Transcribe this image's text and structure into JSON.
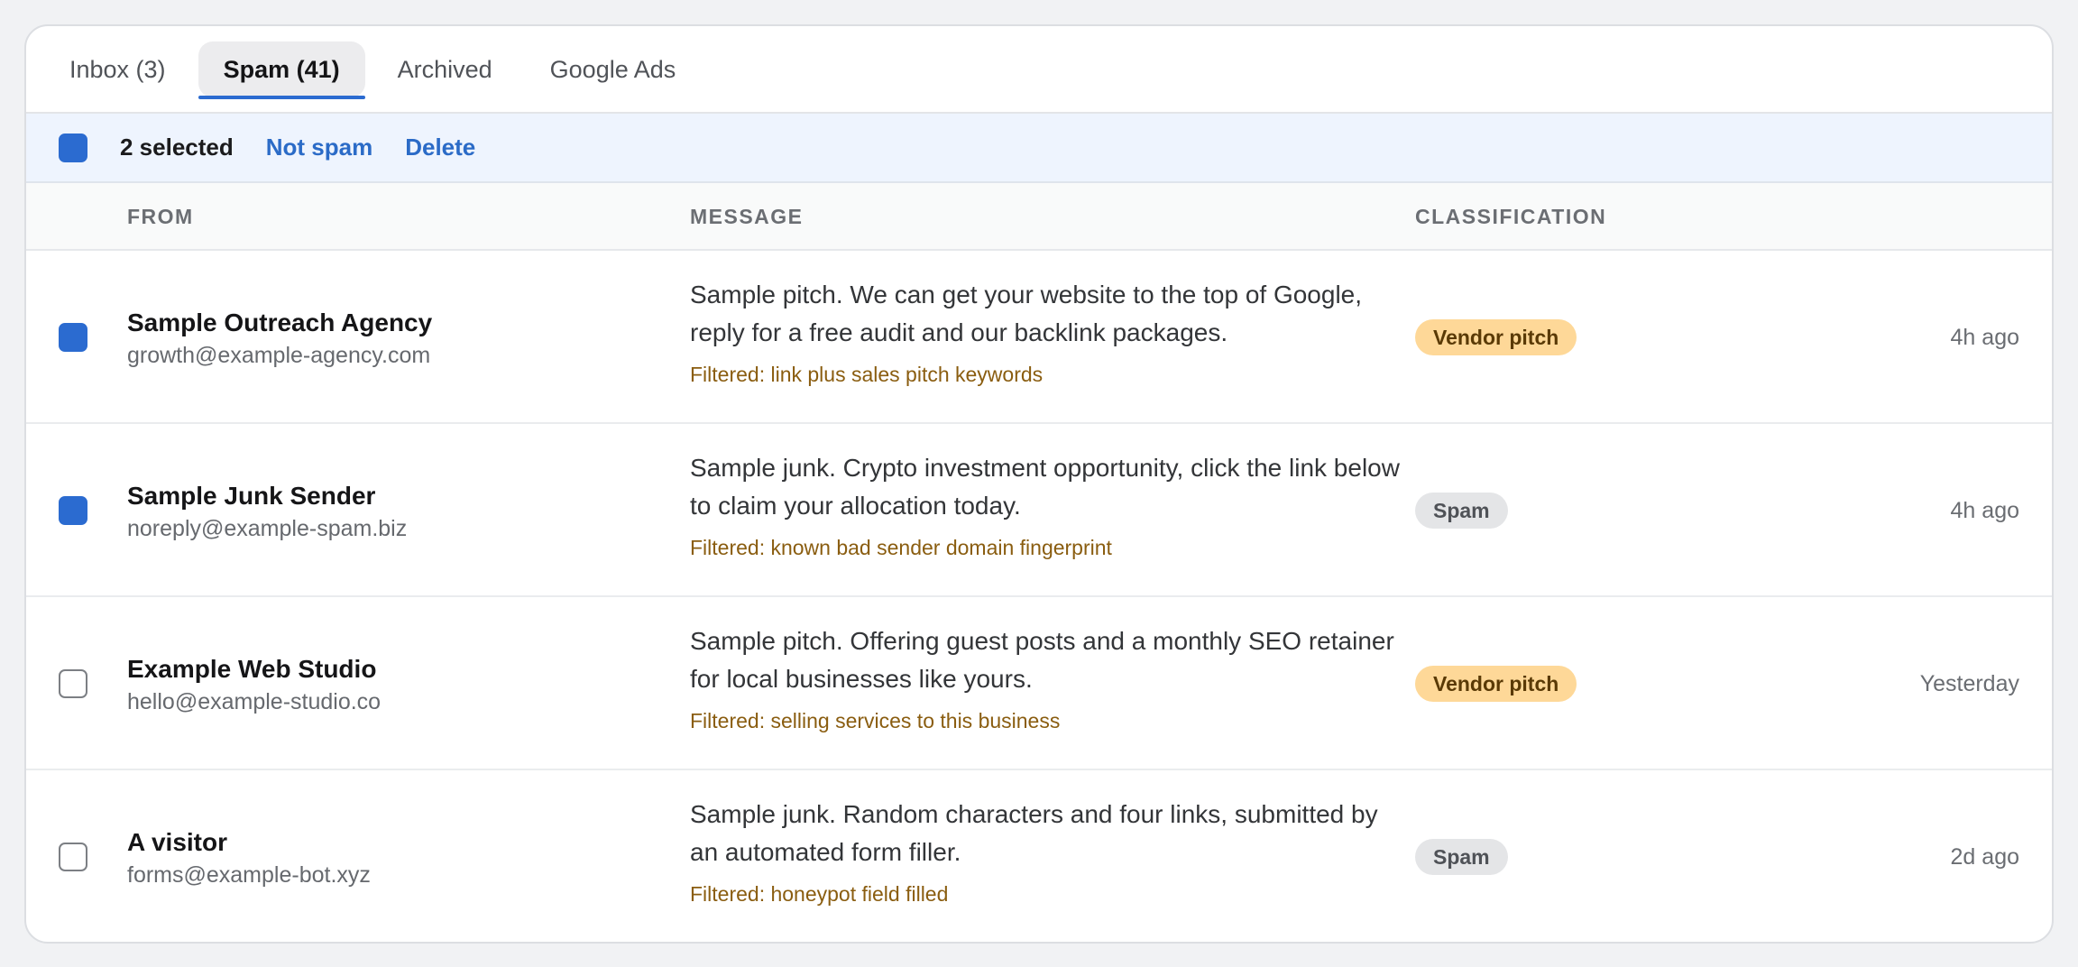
{
  "tabs": [
    {
      "label": "Inbox (3)",
      "active": false
    },
    {
      "label": "Spam (41)",
      "active": true
    },
    {
      "label": "Archived",
      "active": false
    },
    {
      "label": "Google Ads",
      "active": false
    }
  ],
  "bulk": {
    "selected_label": "2 selected",
    "not_spam_label": "Not spam",
    "delete_label": "Delete"
  },
  "columns": {
    "from": "FROM",
    "message": "MESSAGE",
    "classification": "CLASSIFICATION"
  },
  "rows": [
    {
      "checked": true,
      "sender_name": "Sample Outreach Agency",
      "sender_email": "growth@example-agency.com",
      "message": "Sample pitch. We can get your website to the top of Google, reply for a free audit and our backlink packages.",
      "filter": "Filtered: link plus sales pitch keywords",
      "classification": "Vendor pitch",
      "time": "4h ago"
    },
    {
      "checked": true,
      "sender_name": "Sample Junk Sender",
      "sender_email": "noreply@example-spam.biz",
      "message": "Sample junk. Crypto investment opportunity, click the link below to claim your allocation today.",
      "filter": "Filtered: known bad sender domain fingerprint",
      "classification": "Spam",
      "time": "4h ago"
    },
    {
      "checked": false,
      "sender_name": "Example Web Studio",
      "sender_email": "hello@example-studio.co",
      "message": "Sample pitch. Offering guest posts and a monthly SEO retainer for local businesses like yours.",
      "filter": "Filtered: selling services to this business",
      "classification": "Vendor pitch",
      "time": "Yesterday"
    },
    {
      "checked": false,
      "sender_name": "A visitor",
      "sender_email": "forms@example-bot.xyz",
      "message": "Sample junk. Random characters and four links, submitted by an automated form filler.",
      "filter": "Filtered: honeypot field filled",
      "classification": "Spam",
      "time": "2d ago"
    }
  ],
  "colors": {
    "accent": "#2b6bd0",
    "vendor_badge": "#fed898",
    "spam_badge": "#e4e5e7",
    "filter_text": "#8a5d10",
    "bulk_bar": "#eef4fe"
  }
}
